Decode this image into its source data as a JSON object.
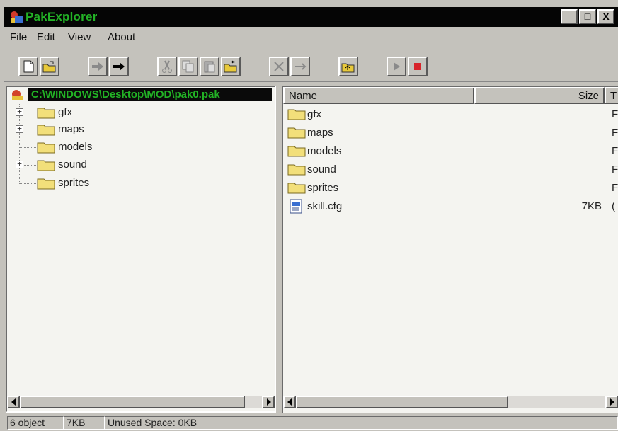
{
  "window": {
    "title": "PakExplorer",
    "buttons": {
      "minimize": "_",
      "maximize": "□",
      "close": "X"
    }
  },
  "menu": {
    "items": [
      {
        "label": "File"
      },
      {
        "label": "Edit"
      },
      {
        "label": "View"
      },
      {
        "label": "About"
      }
    ]
  },
  "toolbar": {
    "buttons": [
      {
        "icon": "new-file-icon"
      },
      {
        "icon": "open-folder-icon"
      },
      {
        "icon": "gray-arrow-right-icon"
      },
      {
        "icon": "black-arrow-right-icon"
      },
      {
        "icon": "cut-icon"
      },
      {
        "icon": "copy-icon"
      },
      {
        "icon": "paste-icon"
      },
      {
        "icon": "folder-open-icon"
      },
      {
        "icon": "delete-icon"
      },
      {
        "icon": "rename-icon"
      },
      {
        "icon": "up-folder-icon"
      },
      {
        "icon": "play-icon"
      },
      {
        "icon": "stop-icon"
      }
    ]
  },
  "tree": {
    "root_path": "C:\\WINDOWS\\Desktop\\MOD\\pak0.pak",
    "items": [
      {
        "label": "gfx",
        "expandable": true
      },
      {
        "label": "maps",
        "expandable": true
      },
      {
        "label": "models",
        "expandable": false
      },
      {
        "label": "sound",
        "expandable": true
      },
      {
        "label": "sprites",
        "expandable": false
      }
    ]
  },
  "list": {
    "columns": {
      "name": "Name",
      "size": "Size",
      "type": "T"
    },
    "rows": [
      {
        "name": "gfx",
        "size": "",
        "type": "F",
        "icon": "folder-icon"
      },
      {
        "name": "maps",
        "size": "",
        "type": "F",
        "icon": "folder-icon"
      },
      {
        "name": "models",
        "size": "",
        "type": "F",
        "icon": "folder-icon"
      },
      {
        "name": "sound",
        "size": "",
        "type": "F",
        "icon": "folder-icon"
      },
      {
        "name": "sprites",
        "size": "",
        "type": "F",
        "icon": "folder-icon"
      },
      {
        "name": "skill.cfg",
        "size": "7KB",
        "type": "(",
        "icon": "cfg-file-icon"
      }
    ]
  },
  "status": {
    "objects": "6 object",
    "size": "7KB",
    "unused": "Unused Space:  0KB"
  },
  "colors": {
    "titlebar_bg": "#050505",
    "title_text": "#23b326",
    "folder": "#f2df7a",
    "window_bg": "#c4c2bc"
  }
}
